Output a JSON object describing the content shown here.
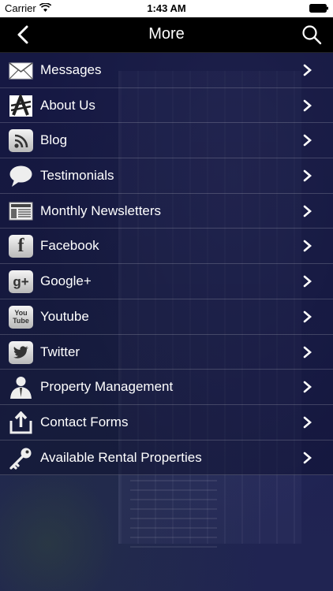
{
  "status_bar": {
    "carrier": "Carrier",
    "time": "1:43 AM"
  },
  "nav": {
    "title": "More",
    "back_icon": "chevron-left-icon",
    "search_icon": "search-icon"
  },
  "menu": [
    {
      "label": "Messages",
      "icon": "envelope-icon"
    },
    {
      "label": "About Us",
      "icon": "about-us-icon"
    },
    {
      "label": "Blog",
      "icon": "rss-icon"
    },
    {
      "label": "Testimonials",
      "icon": "speech-bubble-icon"
    },
    {
      "label": "Monthly Newsletters",
      "icon": "newspaper-icon"
    },
    {
      "label": "Facebook",
      "icon": "facebook-icon"
    },
    {
      "label": "Google+",
      "icon": "google-plus-icon"
    },
    {
      "label": "Youtube",
      "icon": "youtube-icon"
    },
    {
      "label": "Twitter",
      "icon": "twitter-icon"
    },
    {
      "label": "Property Management",
      "icon": "person-icon"
    },
    {
      "label": "Contact Forms",
      "icon": "upload-tray-icon"
    },
    {
      "label": "Available Rental Properties",
      "icon": "key-icon"
    }
  ],
  "icon_glyphs": {
    "facebook": "f",
    "google": "g+",
    "youtube_top": "You",
    "youtube_bottom": "Tube"
  }
}
